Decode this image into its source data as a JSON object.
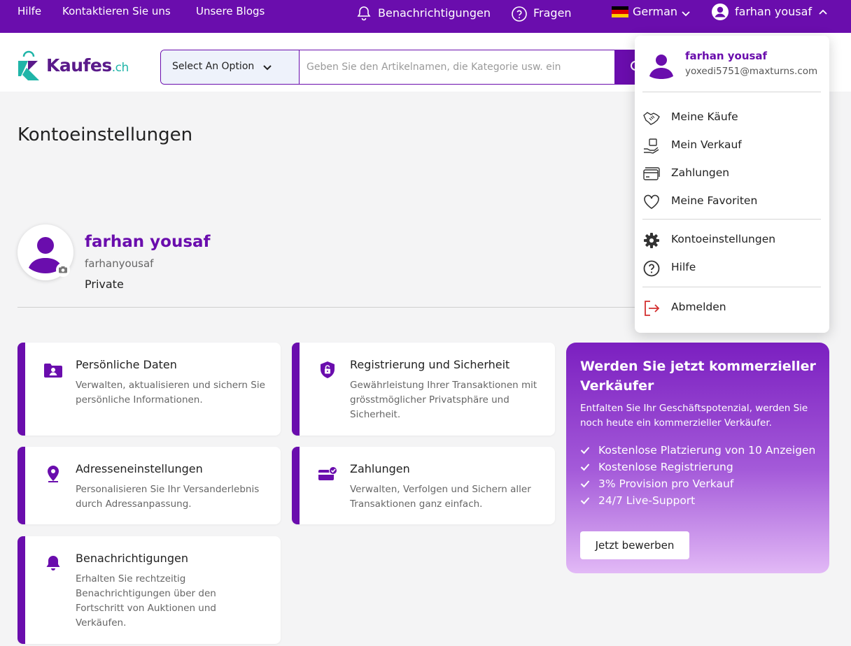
{
  "topbar": {
    "links": {
      "help": "Hilfe",
      "contact": "Kontaktieren Sie uns",
      "blogs": "Unsere Blogs"
    },
    "notifications": "Benachrichtigungen",
    "questions": "Fragen",
    "language": "German",
    "user": "farhan yousaf"
  },
  "header": {
    "logo_text": "Kaufes",
    "logo_tld": ".ch",
    "select_label": "Select An Option",
    "search_placeholder": "Geben Sie den Artikelnamen, die Kategorie usw. ein"
  },
  "page": {
    "title": "Kontoeinstellungen",
    "profile": {
      "name": "farhan yousaf",
      "username": "farhanyousaf",
      "type": "Private"
    }
  },
  "cards": [
    {
      "title": "Persönliche Daten",
      "desc": "Verwalten, aktualisieren und sichern Sie persönliche Informationen.",
      "icon": "personal-data-icon"
    },
    {
      "title": "Registrierung und Sicherheit",
      "desc": "Gewährleistung Ihrer Transaktionen mit grösstmöglicher Privatsphäre und Sicherheit.",
      "icon": "security-lock-icon"
    },
    {
      "title": "Adresseneinstellungen",
      "desc": "Personalisieren Sie Ihr Versanderlebnis durch Adressanpassung.",
      "icon": "location-pin-icon"
    },
    {
      "title": "Zahlungen",
      "desc": "Verwalten, Verfolgen und Sichern aller Transaktionen ganz einfach.",
      "icon": "payment-card-icon"
    },
    {
      "title": "Benachrichtigungen",
      "desc": "Erhalten Sie rechtzeitig Benachrichtigungen über den Fortschritt von Auktionen und Verkäufen.",
      "icon": "bell-icon"
    }
  ],
  "promo": {
    "title": "Werden Sie jetzt kommerzieller Verkäufer",
    "desc": "Entfalten Sie Ihr Geschäftspotenzial, werden Sie noch heute ein kommerzieller Verkäufer.",
    "items": [
      "Kostenlose Platzierung von 10 Anzeigen",
      "Kostenlose Registrierung",
      "3% Provision pro Verkauf",
      "24/7 Live-Support"
    ],
    "button": "Jetzt bewerben"
  },
  "menu": {
    "name": "farhan yousaf",
    "email": "yoxedi5751@maxturns.com",
    "items": [
      {
        "label": "Meine Käufe",
        "icon": "handshake-icon"
      },
      {
        "label": "Mein Verkauf",
        "icon": "sale-hand-icon"
      },
      {
        "label": "Zahlungen",
        "icon": "card-icon"
      },
      {
        "label": "Meine Favoriten",
        "icon": "heart-icon"
      },
      {
        "label": "Kontoeinstellungen",
        "icon": "gear-icon"
      },
      {
        "label": "Hilfe",
        "icon": "question-icon"
      },
      {
        "label": "Abmelden",
        "icon": "logout-icon"
      }
    ]
  },
  "colors": {
    "primary": "#6a0dad",
    "teal": "#20b5a8",
    "logout": "#d32f2f"
  }
}
